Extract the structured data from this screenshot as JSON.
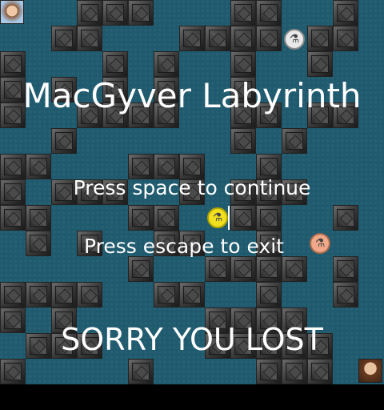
{
  "title": "MacGyver Labyrinth",
  "prompt_continue": "Press space to continue",
  "prompt_exit": "Press escape to exit",
  "result": "SORRY YOU LOST",
  "colors": {
    "floor": "#1f5a6e",
    "wall": "#3a3a3a",
    "text": "#ffffff"
  },
  "icons": {
    "player": "macgyver-avatar",
    "guard": "guardian-avatar",
    "items": [
      "needle-icon",
      "ether-icon",
      "tube-icon"
    ]
  },
  "maze": [
    "...###...##..#",
    "..##...####.##",
    "#...#.#..#..#.",
    "#.#.#.#..#....",
    "#..####..##.##",
    "..#......#.#..",
    "##...###..#...",
    "#.###..#.###..",
    "##...##..##..#",
    ".#.#..##..#...",
    ".....#..####.#",
    "####..##..#..#",
    "#.#.....####..",
    ".###....#####.",
    "#....#....###."
  ]
}
